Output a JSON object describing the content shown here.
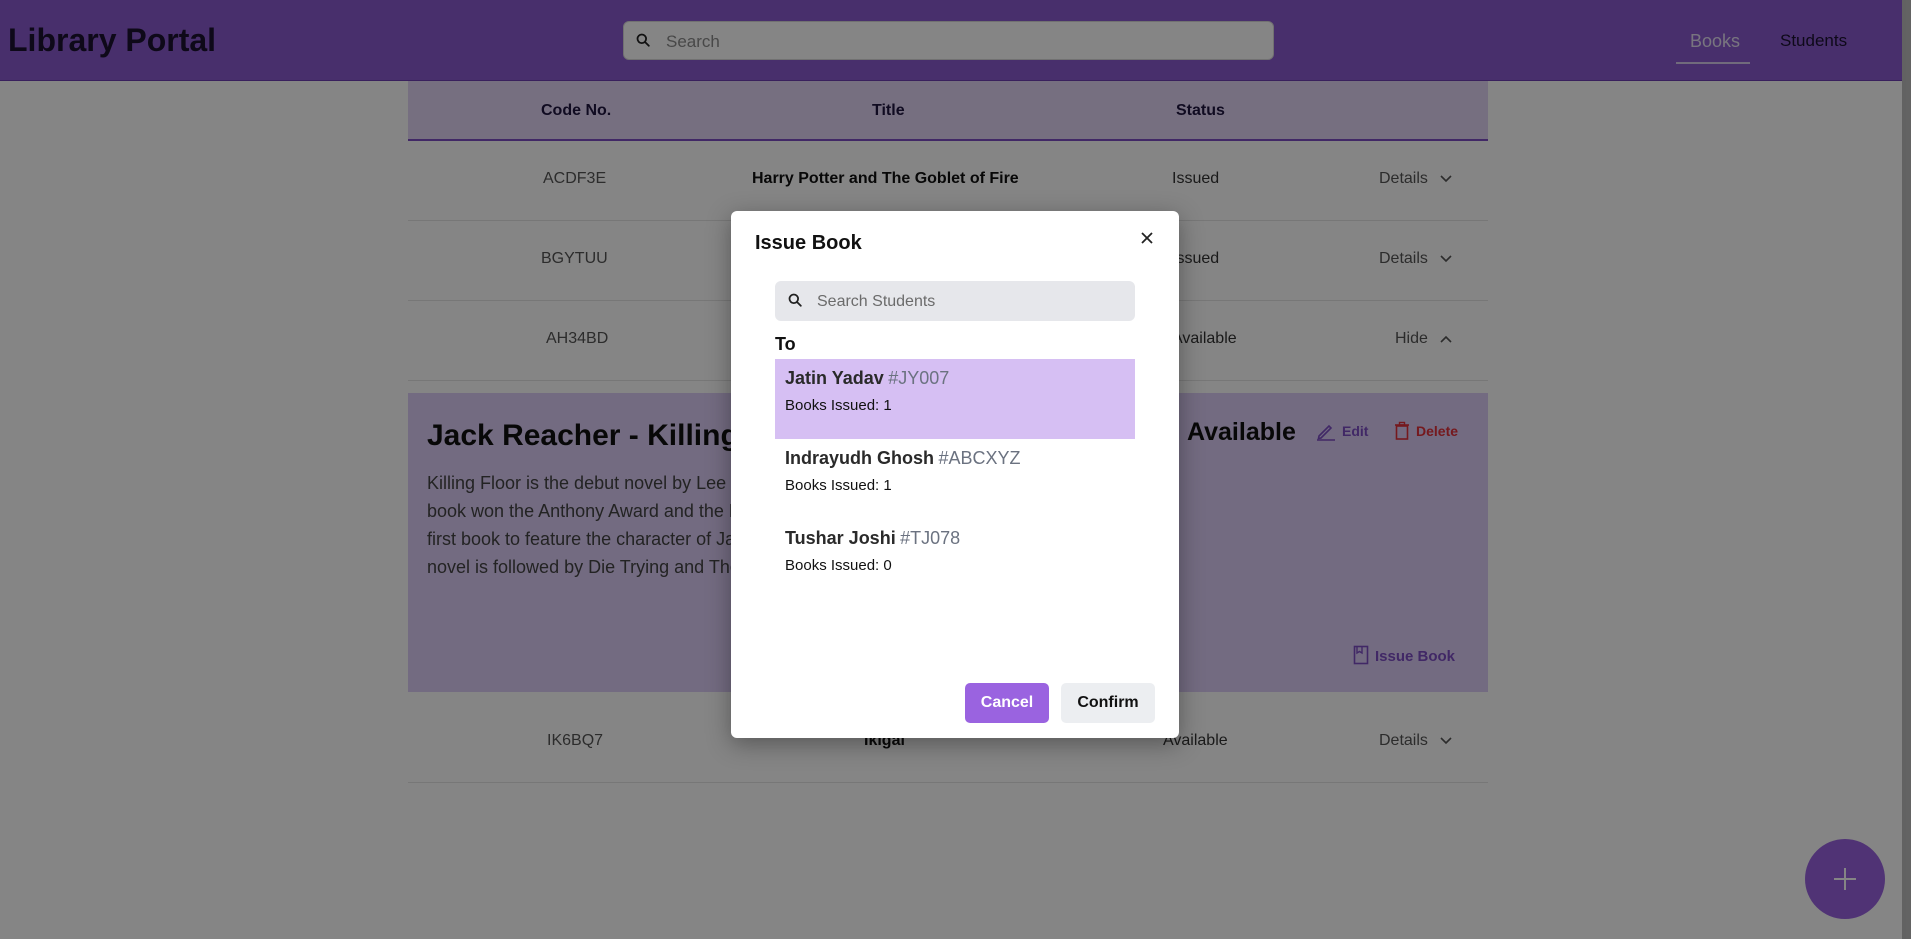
{
  "header": {
    "brand": "Library Portal",
    "search_placeholder": "Search",
    "nav": {
      "books": "Books",
      "students": "Students"
    }
  },
  "table": {
    "columns": {
      "code": "Code No.",
      "title": "Title",
      "status": "Status"
    },
    "rows": [
      {
        "code": "ACDF3E",
        "title": "Harry Potter and The Goblet of Fire",
        "status": "Issued",
        "action": "Details"
      },
      {
        "code": "BGYTUU",
        "title": "",
        "status": "Issued",
        "action": "Details"
      },
      {
        "code": "AH34BD",
        "title": "",
        "status": "Available",
        "action": "Hide"
      },
      {
        "code": "IK6BQ7",
        "title": "Ikigai",
        "status": "Available",
        "action": "Details"
      }
    ]
  },
  "detail": {
    "title": "Jack Reacher - Killing Floor",
    "status": "Available",
    "edit_label": "Edit",
    "delete_label": "Delete",
    "description": "Killing Floor is the debut novel by Lee Child, first published in 1997 by Putnam. The book won the Anthony Award and the Barry Award for best first novel. It is also the first book to feature the character of Jack Reacher, written in the first person. The novel is followed by Die Trying and The Enemy, School, The Affair.",
    "issue_label": "Issue Book"
  },
  "modal": {
    "title": "Issue Book",
    "search_placeholder": "Search Students",
    "to_label": "To",
    "students": [
      {
        "name": "Jatin Yadav",
        "id": "#JY007",
        "books_issued": "Books Issued: 1",
        "selected": true
      },
      {
        "name": "Indrayudh Ghosh",
        "id": "#ABCXYZ",
        "books_issued": "Books Issued: 1",
        "selected": false
      },
      {
        "name": "Tushar Joshi",
        "id": "#TJ078",
        "books_issued": "Books Issued: 0",
        "selected": false
      }
    ],
    "cancel_label": "Cancel",
    "confirm_label": "Confirm"
  },
  "colors": {
    "accent": "#9a63e0",
    "header": "#8b5bd0",
    "selected_row": "#d6bff3",
    "danger": "#e0303a"
  },
  "icons": [
    "search-icon",
    "chevron-down-icon",
    "chevron-up-icon",
    "pencil-icon",
    "trash-icon",
    "book-icon",
    "close-icon",
    "plus-icon"
  ]
}
